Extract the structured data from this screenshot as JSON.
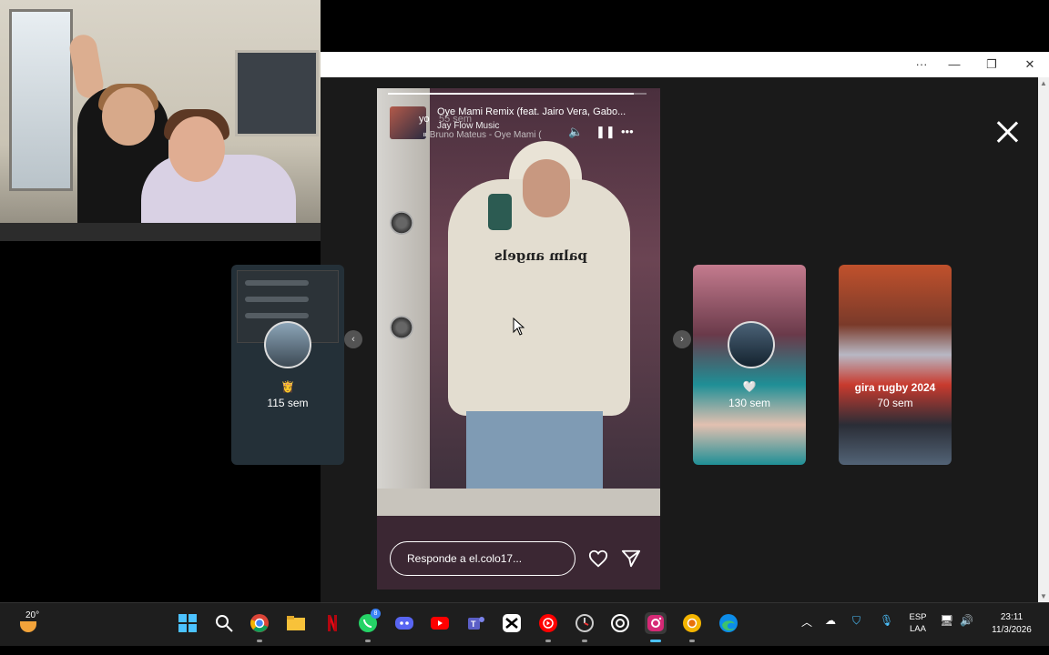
{
  "window": {
    "more_label": "···",
    "minimize_label": "—",
    "restore_label": "❐",
    "close_label": "✕"
  },
  "story": {
    "music": {
      "overlay_user": "yo",
      "overlay_age": "55 sem",
      "song": "Oye Mami Remix (feat. Jairo Vera, Gabo...",
      "artist": "Jay Flow Music",
      "next": "Bruno Mateus - Oye Mami (",
      "progress": 0.95
    },
    "hoodie_text": "palm angels",
    "reply_placeholder": "Responde a el.colo17..."
  },
  "cards": {
    "left": {
      "age": "115 sem"
    },
    "middle": {
      "age": "130 sem"
    },
    "right": {
      "title": "gira rugby 2024",
      "age": "70 sem"
    }
  },
  "taskbar": {
    "weather_temp": "20°",
    "icons": [
      "windows-start",
      "search",
      "chrome",
      "file-explorer",
      "netflix",
      "whatsapp",
      "discord",
      "youtube",
      "teams",
      "capcut",
      "youtube-music",
      "clock-app",
      "chatgpt",
      "instagram",
      "chrome-canary",
      "edge"
    ],
    "whatsapp_badge": "8",
    "lang_line1": "ESP",
    "lang_line2": "LAA",
    "time": "23:11",
    "date": "11/3/2026"
  }
}
